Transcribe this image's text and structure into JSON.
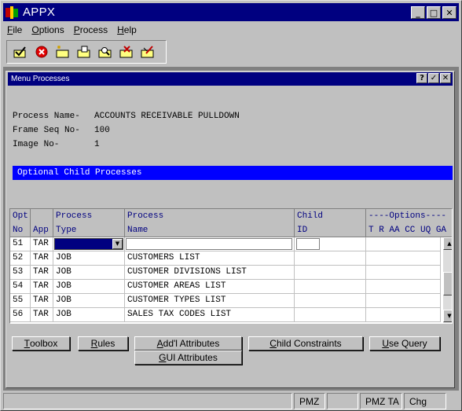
{
  "app": {
    "title": "APPX"
  },
  "window_controls": {
    "minimize": "_",
    "maximize": "□",
    "close": "✕"
  },
  "menubar": [
    {
      "label": "File"
    },
    {
      "label": "Options"
    },
    {
      "label": "Process"
    },
    {
      "label": "Help"
    }
  ],
  "toolbar": {
    "icons": [
      "check-folder-icon",
      "cancel-icon",
      "new-folder-icon",
      "open-folder-icon",
      "find-folder-icon",
      "delete-folder-icon",
      "edit-folder-icon"
    ]
  },
  "child_window": {
    "title": "Menu Processes",
    "controls": {
      "help": "?",
      "ok": "✓",
      "close": "✕"
    }
  },
  "fields": {
    "process_name": {
      "label": "Process Name-",
      "value": "ACCOUNTS RECEIVABLE PULLDOWN"
    },
    "frame_seq": {
      "label": "Frame Seq No-",
      "value": "100"
    },
    "image_no": {
      "label": "Image No-",
      "value": "1"
    }
  },
  "section": {
    "title": "Optional Child Processes"
  },
  "grid": {
    "headers": {
      "opt": [
        "Opt",
        "No"
      ],
      "app": [
        "",
        "App"
      ],
      "ptype": [
        "Process",
        "Type"
      ],
      "pname": [
        "Process",
        "Name"
      ],
      "child": [
        "Child",
        "ID"
      ],
      "options": [
        "----Options----",
        "T R AA CC UQ GA"
      ]
    },
    "rows": [
      {
        "opt": "51",
        "app": "TAR",
        "type": "",
        "name": "",
        "child": ""
      },
      {
        "opt": "52",
        "app": "TAR",
        "type": "JOB",
        "name": "CUSTOMERS LIST",
        "child": ""
      },
      {
        "opt": "53",
        "app": "TAR",
        "type": "JOB",
        "name": "CUSTOMER DIVISIONS LIST",
        "child": ""
      },
      {
        "opt": "54",
        "app": "TAR",
        "type": "JOB",
        "name": "CUSTOMER AREAS LIST",
        "child": ""
      },
      {
        "opt": "55",
        "app": "TAR",
        "type": "JOB",
        "name": "CUSTOMER TYPES LIST",
        "child": ""
      },
      {
        "opt": "56",
        "app": "TAR",
        "type": "JOB",
        "name": "SALES TAX CODES LIST",
        "child": ""
      }
    ]
  },
  "buttons": {
    "toolbox": "Toolbox",
    "rules": "Rules",
    "addl_attributes": "Add'l Attributes",
    "child_constraints": "Child Constraints",
    "use_query": "Use Query",
    "gui_attributes": "GUI Attributes"
  },
  "statusbar": [
    "",
    "PMZ",
    "",
    "PMZ TA",
    "Chg"
  ]
}
